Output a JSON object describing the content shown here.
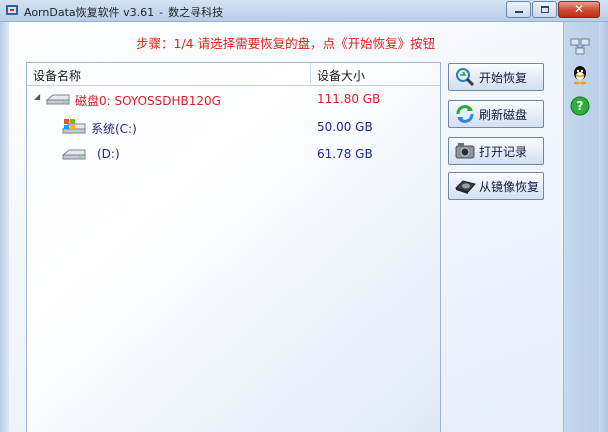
{
  "window": {
    "title": "AornData恢复软件 v3.61",
    "subtitle": "数之寻科技",
    "controls": {
      "minimize": "minimize-icon",
      "maximize": "maximize-icon",
      "close": "close-icon"
    }
  },
  "step_text": "步骤：1/4 请选择需要恢复的盘，点《开始恢复》按钮",
  "device_table": {
    "columns": {
      "name": "设备名称",
      "size": "设备大小"
    },
    "rows": [
      {
        "name": "磁盘0: SOYOSSDHB120G",
        "size": "111.80 GB",
        "icon": "disk-icon",
        "color": "#d81e2b"
      },
      {
        "name": "系统(C:)",
        "size": "50.00 GB",
        "icon": "system-drive-icon",
        "color": "#1c2a8c"
      },
      {
        "name": "(D:)",
        "size": "61.78 GB",
        "icon": "drive-icon",
        "color": "#1c2a8c"
      }
    ]
  },
  "actions": {
    "start": "开始恢复",
    "refresh": "刷新磁盘",
    "open_record": "打开记录",
    "from_image": "从镜像恢复"
  },
  "sidebar_icons": [
    "network-icon",
    "qq-icon",
    "help-icon"
  ],
  "colors": {
    "accent_red": "#e2231a",
    "item_blue": "#1c2a8c"
  }
}
